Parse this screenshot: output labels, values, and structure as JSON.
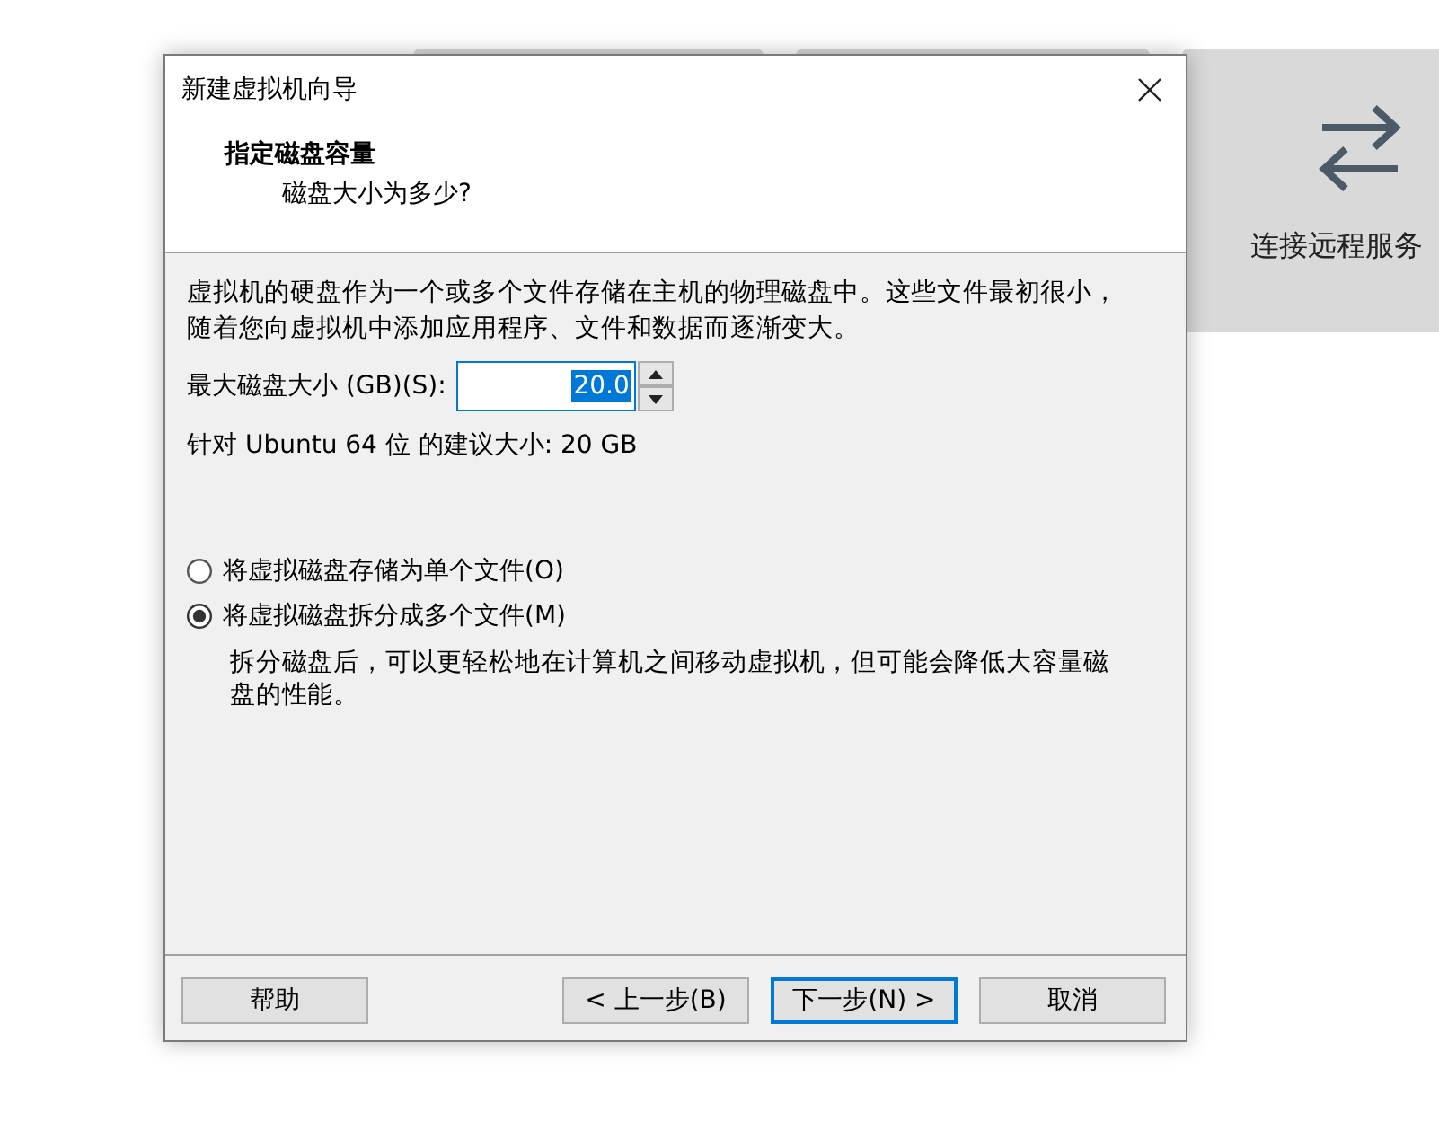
{
  "background": {
    "card": {
      "label": "连接远程服务"
    }
  },
  "dialog": {
    "title": "新建虚拟机向导",
    "header": {
      "title": "指定磁盘容量",
      "subtitle": "磁盘大小为多少?"
    },
    "description": "虚拟机的硬盘作为一个或多个文件存储在主机的物理磁盘中。这些文件最初很小，随着您向虚拟机中添加应用程序、文件和数据而逐渐变大。",
    "disk_size": {
      "label": "最大磁盘大小 (GB)(S):",
      "value": "20.0",
      "text_selected": true
    },
    "recommendation": "针对 Ubuntu 64 位 的建议大小: 20 GB",
    "storage_options": [
      {
        "label": "将虚拟磁盘存储为单个文件(O)",
        "selected": false
      },
      {
        "label": "将虚拟磁盘拆分成多个文件(M)",
        "selected": true,
        "note": "拆分磁盘后，可以更轻松地在计算机之间移动虚拟机，但可能会降低大容量磁盘的性能。"
      }
    ],
    "buttons": [
      {
        "label": "帮助",
        "default": false
      },
      {
        "label": "< 上一步(B)",
        "default": false
      },
      {
        "label": "下一步(N) >",
        "default": true
      },
      {
        "label": "取消",
        "default": false
      }
    ]
  }
}
